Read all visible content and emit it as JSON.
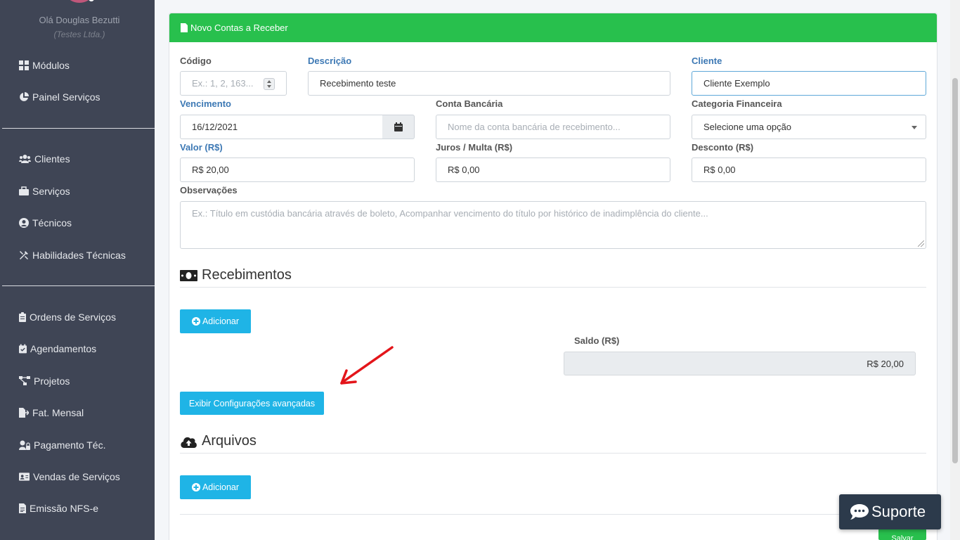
{
  "sidebar": {
    "greeting": "Olá Douglas Bezutti",
    "company": "(Testes Ltda.)",
    "items": [
      {
        "label": "Módulos",
        "icon": "grid-icon"
      },
      {
        "label": "Painel Serviços",
        "icon": "pie-chart-icon"
      },
      {
        "label": "Clientes",
        "icon": "users-icon"
      },
      {
        "label": "Serviços",
        "icon": "briefcase-icon"
      },
      {
        "label": "Técnicos",
        "icon": "user-circle-icon"
      },
      {
        "label": "Habilidades Técnicas",
        "icon": "tools-icon"
      },
      {
        "label": "Ordens de Serviços",
        "icon": "clipboard-icon"
      },
      {
        "label": "Agendamentos",
        "icon": "calendar-check-icon"
      },
      {
        "label": "Projetos",
        "icon": "project-diagram-icon"
      },
      {
        "label": "Fat. Mensal",
        "icon": "file-export-icon"
      },
      {
        "label": "Pagamento Téc.",
        "icon": "user-lock-icon"
      },
      {
        "label": "Vendas de Serviços",
        "icon": "id-card-icon"
      },
      {
        "label": "Emissão NFS-e",
        "icon": "file-invoice-icon"
      }
    ]
  },
  "form": {
    "header_title": "Novo Contas a Receber",
    "codigo": {
      "label": "Código",
      "placeholder": "Ex.: 1, 2, 163..."
    },
    "descricao": {
      "label": "Descrição",
      "value": "Recebimento teste"
    },
    "cliente": {
      "label": "Cliente",
      "value": "Cliente Exemplo"
    },
    "vencimento": {
      "label": "Vencimento",
      "value": "16/12/2021"
    },
    "conta_bancaria": {
      "label": "Conta Bancária",
      "placeholder": "Nome da conta bancária de recebimento..."
    },
    "categoria": {
      "label": "Categoria Financeira",
      "value": "Selecione uma opção"
    },
    "valor": {
      "label": "Valor (R$)",
      "value": "R$ 20,00"
    },
    "juros": {
      "label": "Juros / Multa (R$)",
      "value": "R$ 0,00"
    },
    "desconto": {
      "label": "Desconto (R$)",
      "value": "R$ 0,00"
    },
    "observacoes": {
      "label": "Observações",
      "placeholder": "Ex.: Título em custódia bancária através de boleto, Acompanhar vencimento do título por histórico de inadimplência do cliente..."
    }
  },
  "recebimentos": {
    "title": "Recebimentos",
    "add_label": "Adicionar",
    "saldo_label": "Saldo (R$)",
    "saldo_value": "R$ 20,00",
    "advanced_label": "Exibir Configurações avançadas"
  },
  "arquivos": {
    "title": "Arquivos",
    "add_label": "Adicionar"
  },
  "save_label": "Salvar",
  "support_label": "Suporte",
  "colors": {
    "sidebar": "#3f4555",
    "header_green": "#28c04d",
    "info_blue": "#1fb4e6",
    "arrow_red": "#e3151a"
  }
}
